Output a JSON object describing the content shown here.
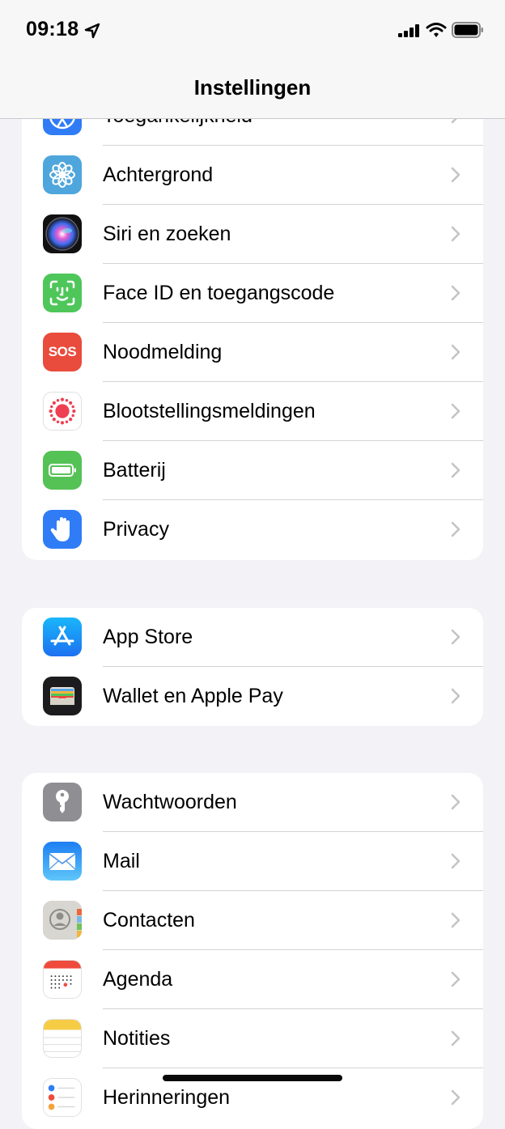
{
  "status": {
    "time": "09:18"
  },
  "nav": {
    "title": "Instellingen"
  },
  "group1": [
    {
      "label": "Toegankelijkheid",
      "icon": "accessibility-icon"
    },
    {
      "label": "Achtergrond",
      "icon": "wallpaper-flower-icon"
    },
    {
      "label": "Siri en zoeken",
      "icon": "siri-icon"
    },
    {
      "label": "Face ID en toegangscode",
      "icon": "face-id-icon"
    },
    {
      "label": "Noodmelding",
      "icon": "sos-icon",
      "icon_text": "SOS"
    },
    {
      "label": "Blootstellingsmeldingen",
      "icon": "exposure-notification-icon"
    },
    {
      "label": "Batterij",
      "icon": "battery-icon"
    },
    {
      "label": "Privacy",
      "icon": "privacy-hand-icon"
    }
  ],
  "group2": [
    {
      "label": "App Store",
      "icon": "app-store-icon"
    },
    {
      "label": "Wallet en Apple Pay",
      "icon": "wallet-icon"
    }
  ],
  "group3": [
    {
      "label": "Wachtwoorden",
      "icon": "key-icon"
    },
    {
      "label": "Mail",
      "icon": "mail-icon"
    },
    {
      "label": "Contacten",
      "icon": "contacts-icon"
    },
    {
      "label": "Agenda",
      "icon": "calendar-icon"
    },
    {
      "label": "Notities",
      "icon": "notes-icon"
    },
    {
      "label": "Herinneringen",
      "icon": "reminders-icon"
    }
  ],
  "colors": {
    "background": "#f2f2f7",
    "separator": "#d4d4d8",
    "chevron": "#c4c4c7",
    "accessibility": "#2f7cf6",
    "wallpaper": "#4ea6dc",
    "face_id": "#4fc65a",
    "sos": "#e94b3c",
    "battery": "#55c255",
    "privacy": "#2f7cf6",
    "app_store": "#1c8ef8",
    "wallet": "#1c1c1e",
    "passwords": "#8e8e93",
    "mail": "#2e8cf6"
  }
}
